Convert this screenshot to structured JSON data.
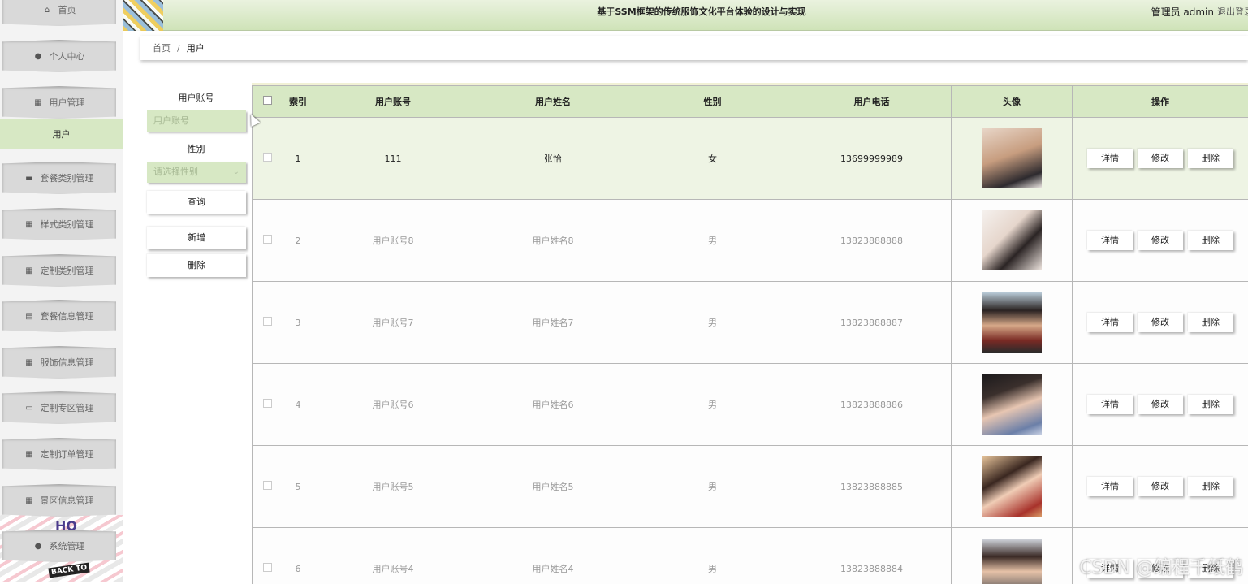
{
  "header": {
    "title": "基于SSM框架的传统服饰文化平台体验的设计与实现",
    "user": "管理员 admin",
    "logout": "退出登录"
  },
  "sidebar": {
    "items": [
      {
        "label": "首页",
        "icon": "home-icon"
      },
      {
        "label": "个人中心",
        "icon": "user-icon"
      },
      {
        "label": "用户管理",
        "icon": "grid-icon"
      },
      {
        "label": "用户",
        "icon": ""
      },
      {
        "label": "套餐类别管理",
        "icon": "briefcase-icon"
      },
      {
        "label": "样式类别管理",
        "icon": "grid-icon"
      },
      {
        "label": "定制类别管理",
        "icon": "grid-icon"
      },
      {
        "label": "套餐信息管理",
        "icon": "clipboard-icon"
      },
      {
        "label": "服饰信息管理",
        "icon": "grid-icon"
      },
      {
        "label": "定制专区管理",
        "icon": "monitor-icon"
      },
      {
        "label": "定制订单管理",
        "icon": "grid-icon"
      },
      {
        "label": "景区信息管理",
        "icon": "grid-icon"
      },
      {
        "label": "系统管理",
        "icon": "location-icon"
      }
    ],
    "deco_text": [
      "HO",
      "BACK TO"
    ]
  },
  "breadcrumb": {
    "home": "首页",
    "sep": "/",
    "current": "用户"
  },
  "search": {
    "account_label": "用户账号",
    "account_placeholder": "用户账号",
    "gender_label": "性别",
    "gender_placeholder": "请选择性别",
    "query_btn": "查询",
    "add_btn": "新增",
    "delete_btn": "删除"
  },
  "table": {
    "headers": [
      "索引",
      "用户账号",
      "用户姓名",
      "性别",
      "用户电话",
      "头像",
      "操作"
    ],
    "actions": [
      "详情",
      "修改",
      "删除"
    ],
    "rows": [
      {
        "index": "1",
        "account": "111",
        "name": "张怡",
        "gender": "女",
        "phone": "13699999989"
      },
      {
        "index": "2",
        "account": "用户账号8",
        "name": "用户姓名8",
        "gender": "男",
        "phone": "13823888888"
      },
      {
        "index": "3",
        "account": "用户账号7",
        "name": "用户姓名7",
        "gender": "男",
        "phone": "13823888887"
      },
      {
        "index": "4",
        "account": "用户账号6",
        "name": "用户姓名6",
        "gender": "男",
        "phone": "13823888886"
      },
      {
        "index": "5",
        "account": "用户账号5",
        "name": "用户姓名5",
        "gender": "男",
        "phone": "13823888885"
      },
      {
        "index": "6",
        "account": "用户账号4",
        "name": "用户姓名4",
        "gender": "男",
        "phone": "13823888884"
      }
    ]
  },
  "watermark": "CSDN @编程千纸鹤",
  "colors": {
    "accent": "#d7e8c4",
    "topbar": "#cfe3b8"
  }
}
